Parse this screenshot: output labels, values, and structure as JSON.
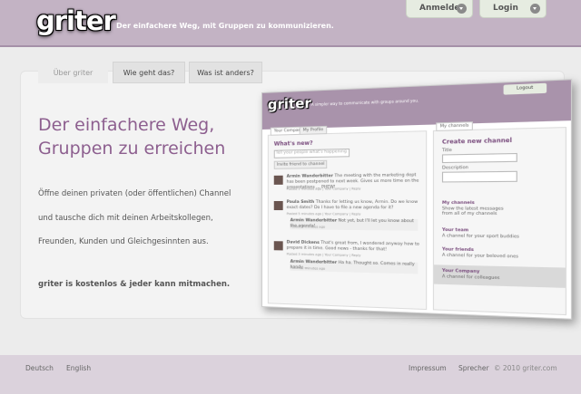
{
  "header": {
    "logo": "griter",
    "tagline": "Der einfachere Weg, mit Gruppen zu kommunizieren.",
    "register_label": "Anmelden",
    "login_label": "Login"
  },
  "tabs": [
    "Über griter",
    "Wie geht das?",
    "Was ist anders?"
  ],
  "main": {
    "headline_1": "Der einfachere Weg,",
    "headline_2": "Gruppen zu erreichen",
    "para_1": "Öffne deinen privaten (oder öffentlichen) Channel",
    "para_2": "und tausche dich mit deinen Arbeitskollegen,",
    "para_3": "Freunden, Kunden und Gleichgesinnten aus.",
    "strong": "griter is kostenlos & jeder kann mitmachen."
  },
  "mock": {
    "logo": "griter",
    "tagline": "A simpler way to communicate with groups around you.",
    "logout": "Logout",
    "tab_company": "Your Company",
    "tab_profile": "My Profile",
    "whats_new": "What's new?",
    "whats_new_placeholder": "Tell your people what's happening ...",
    "invite_label": "Invite friend to channel",
    "posts": [
      {
        "author": "Armin Wanderbitter",
        "text": "The meeting with the marketing dept has been postponed to next week. Gives us more time on the presentations ... PHEW!",
        "meta": "Posted 5 minutes ago | Your Company | Reply"
      },
      {
        "author": "Paula Smith",
        "text": "Thanks for letting us know, Armin. Do we know exact dates? Do I have to file a new agenda for it?",
        "meta": "Posted 5 minutes ago | Your Company | Reply"
      },
      {
        "author": "Armin Wanderbitter",
        "text": "Not yet, but I'll let you know about the agenda!",
        "meta": "Posted 3 minutes ago"
      },
      {
        "author": "David Dickens",
        "text": "That's great from, I wondered anyway how to prepare it in time. Good news - thanks for that!",
        "meta": "Posted 3 minutes ago | Your Company | Reply"
      },
      {
        "author": "Armin Wanderbitter",
        "text": "Ha ha. Thought so. Comes in really handy ...",
        "meta": "Posted 2 minutes ago"
      }
    ],
    "my_channels_tab": "My channels",
    "create_title": "Create new channel",
    "title_label": "Title",
    "description_label": "Description",
    "channels": [
      {
        "name": "My channels",
        "desc": "Show the latest messages from all of my channels"
      },
      {
        "name": "Your team",
        "desc": "A channel for your sport buddies"
      },
      {
        "name": "Your friends",
        "desc": "A channel for your beloved ones"
      },
      {
        "name": "Your Company",
        "desc": "A channel for colleagues"
      }
    ]
  },
  "footer": {
    "lang_de": "Deutsch",
    "lang_en": "English",
    "impressum": "Impressum",
    "speaker": "Sprecher",
    "copyright": "© 2010 griter.com"
  }
}
